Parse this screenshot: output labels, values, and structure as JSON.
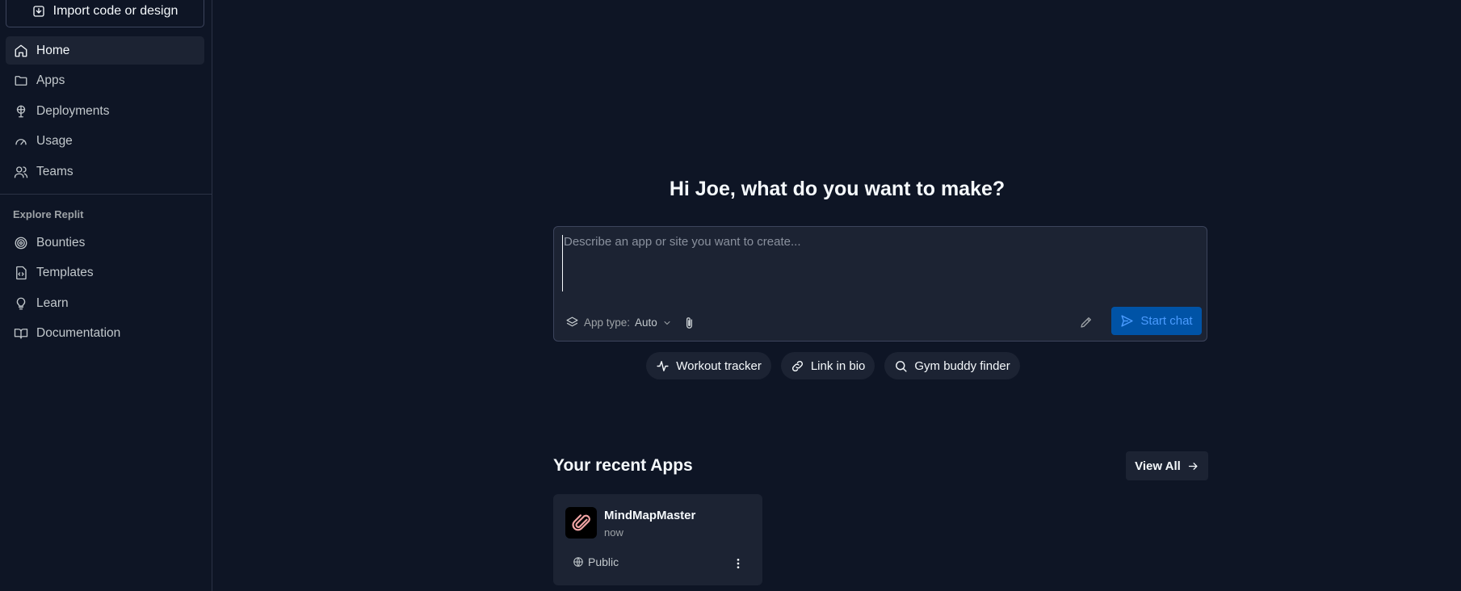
{
  "sidebar": {
    "import_label": "Import code or design",
    "nav": [
      {
        "label": "Home",
        "icon": "home-icon",
        "active": true
      },
      {
        "label": "Apps",
        "icon": "folder-icon"
      },
      {
        "label": "Deployments",
        "icon": "deployments-icon"
      },
      {
        "label": "Usage",
        "icon": "gauge-icon"
      },
      {
        "label": "Teams",
        "icon": "users-icon"
      }
    ],
    "explore_label": "Explore Replit",
    "explore": [
      {
        "label": "Bounties",
        "icon": "target-icon"
      },
      {
        "label": "Templates",
        "icon": "file-code-icon"
      },
      {
        "label": "Learn",
        "icon": "lightbulb-icon"
      },
      {
        "label": "Documentation",
        "icon": "book-icon"
      }
    ]
  },
  "main": {
    "headline": "Hi Joe, what do you want to make?",
    "prompt": {
      "placeholder": "Describe an app or site you want to create...",
      "value": "",
      "app_type_label": "App type:",
      "app_type_value": "Auto",
      "start_label": "Start chat"
    },
    "suggestions": [
      {
        "label": "Workout tracker",
        "icon": "activity-icon"
      },
      {
        "label": "Link in bio",
        "icon": "link-icon"
      },
      {
        "label": "Gym buddy finder",
        "icon": "search-icon"
      }
    ],
    "recent": {
      "title": "Your recent Apps",
      "view_all_label": "View All",
      "apps": [
        {
          "name": "MindMapMaster",
          "time": "now",
          "visibility": "Public"
        }
      ]
    }
  },
  "colors": {
    "background": "#0e1525",
    "surface": "#1c2333",
    "accent": "#0053a6",
    "accent_text": "#4a9bff"
  }
}
